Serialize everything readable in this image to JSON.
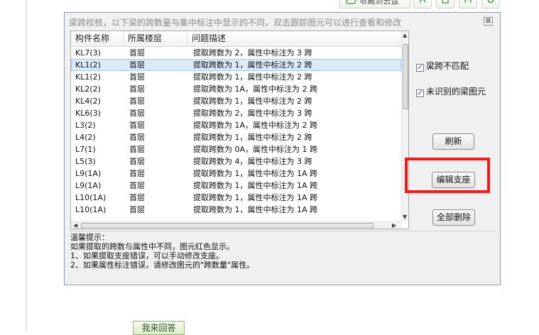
{
  "top_bar": {
    "favorite_label": "收藏到云盘",
    "icons": [
      "cloud-icon",
      "network-icon",
      "save-icon",
      "share-icon",
      "settings-icon"
    ]
  },
  "dialog": {
    "title": "梁跨校核，以下梁的跨数量与集中标注中显示的不同，双击跟踪图元可以进行查看和修改",
    "close_glyph": "⊠",
    "table": {
      "columns": [
        "构件名称",
        "所属楼层",
        "问题描述"
      ],
      "selected_index": 1,
      "rows": [
        [
          "KL7(3)",
          "首层",
          "提取跨数为 2，属性中标注为 3 跨"
        ],
        [
          "KL1(2)",
          "首层",
          "提取跨数为 1，属性中标注为 2 跨"
        ],
        [
          "KL1(2)",
          "首层",
          "提取跨数为 1，属性中标注为 2 跨"
        ],
        [
          "KL2(2)",
          "首层",
          "提取跨数为 1A，属性中标注为 2 跨"
        ],
        [
          "KL4(2)",
          "首层",
          "提取跨数为 1，属性中标注为 2 跨"
        ],
        [
          "KL6(3)",
          "首层",
          "提取跨数为 2，属性中标注为 3 跨"
        ],
        [
          "L3(2)",
          "首层",
          "提取跨数为 1A，属性中标注为 2 跨"
        ],
        [
          "L4(2)",
          "首层",
          "提取跨数为 1，属性中标注为 2 跨"
        ],
        [
          "L7(1)",
          "首层",
          "提取跨数为 0A，属性中标注为 1 跨"
        ],
        [
          "L5(3)",
          "首层",
          "提取跨数为 4，属性中标注为 3 跨"
        ],
        [
          "L9(1A)",
          "首层",
          "提取跨数为 1，属性中标注为 1A 跨"
        ],
        [
          "L9(1A)",
          "首层",
          "提取跨数为 1，属性中标注为 1A 跨"
        ],
        [
          "L10(1A)",
          "首层",
          "提取跨数为 1，属性中标注为 1A 跨"
        ],
        [
          "L10(1A)",
          "首层",
          "提取跨数为 1，属性中标注为 1A 跨"
        ]
      ]
    },
    "checkboxes": [
      {
        "label": "梁跨不匹配",
        "checked": true
      },
      {
        "label": "未识别的梁图元",
        "checked": true
      }
    ],
    "buttons": {
      "refresh": "刷新",
      "edit_support": "编辑支座",
      "delete_all": "全部删除"
    },
    "tips": [
      "温馨提示：",
      "如果提取的跨数与属性中不同，图元红色显示。",
      "1、如果提取支座错误，可以手动修改支座。",
      "2、如果属性标注错误，请修改图元的\"跨数量\"属性。"
    ]
  },
  "answer_button": "我来回答",
  "colors": {
    "highlight": "#ee1c1c",
    "selected_row": "#dbe9f8",
    "answer_button": "#dcefc9"
  }
}
